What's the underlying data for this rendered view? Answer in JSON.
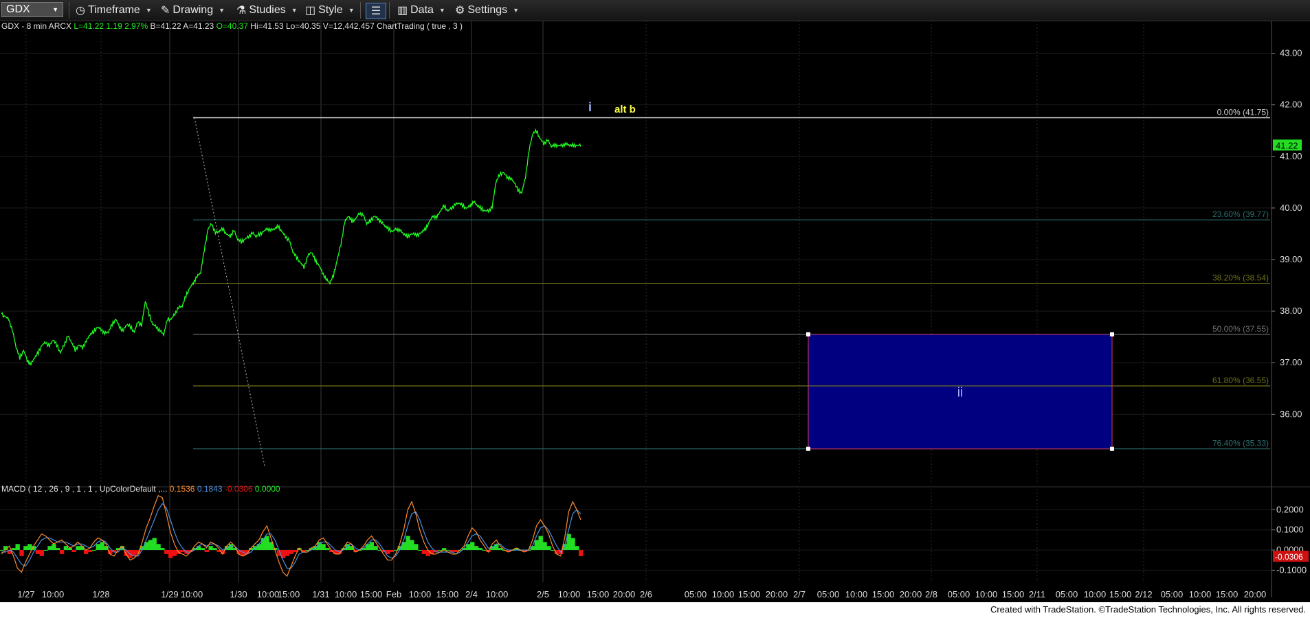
{
  "toolbar": {
    "symbol": "GDX",
    "timeframe": "Timeframe",
    "drawing": "Drawing",
    "studies": "Studies",
    "style": "Style",
    "data": "Data",
    "settings": "Settings"
  },
  "header": {
    "title": "GDX - 8 min  ARCX",
    "last": "L=41.22",
    "chg": "1.19",
    "pct": "2.97%",
    "bid": "B=41.22",
    "ask": "A=41.23",
    "open": "O=40.37",
    "high": "Hi=41.53",
    "low": "Lo=40.35",
    "volume": "V=12,442,457",
    "study": "ChartTrading ( true , 3 )"
  },
  "macd_header": {
    "title": "MACD ( 12 , 26 , 9 , 1 , 1 , UpColorDefault ,...",
    "v1": "0.1536",
    "v2": "0.1843",
    "v3": "-0.0306",
    "v4": "0.0000"
  },
  "footer": "Created with TradeStation. ©TradeStation Technologies, Inc. All rights reserved.",
  "colors": {
    "price": "#22ff22",
    "fib_0": "#d8d8d8",
    "fib_236": "#2e6e6e",
    "fib_382": "#70701e",
    "fib_50": "#707070",
    "fib_618": "#70701e",
    "fib_764": "#2e6e6e",
    "box_fill": "#000080",
    "box_border": "#b03060",
    "macd_pos": "#22dd22",
    "macd_neg": "#ee1111",
    "macd_line": "#ff8c2e",
    "signal_line": "#4a8fe0",
    "label_i": "#9fb3ff",
    "label_altb": "#ffff44",
    "last_price_bg": "#22dd22"
  },
  "chart_data": {
    "type": "line",
    "title": "GDX - 8 min",
    "ylim": [
      34.66,
      43.5
    ],
    "yticks": [
      43,
      42,
      41,
      40,
      39,
      38,
      37,
      36
    ],
    "ytick_labels": [
      "43.00",
      "42.00",
      "41.00",
      "40.00",
      "39.00",
      "38.00",
      "37.00",
      "36.00"
    ],
    "last_price": 41.22,
    "last_price_label": "41.22",
    "x_ticks": [
      "1/27",
      "10:00",
      "1/28",
      "1/29",
      "10:00",
      "1/30",
      "10:00",
      "15:00",
      "1/31",
      "10:00",
      "15:00",
      "Feb",
      "10:00",
      "15:00",
      "2/4",
      "10:00",
      "2/5",
      "10:00",
      "15:00",
      "20:00",
      "2/6",
      "05:00",
      "10:00",
      "15:00",
      "20:00",
      "2/7",
      "05:00",
      "10:00",
      "15:00",
      "20:00",
      "2/8",
      "05:00",
      "10:00",
      "15:00",
      "2/11",
      "05:00",
      "10:00",
      "15:00",
      "2/12",
      "05:00",
      "10:00",
      "15:00",
      "20:00"
    ],
    "price_series": {
      "name": "GDX",
      "x": [
        0,
        2,
        4,
        5,
        6,
        7,
        8,
        9,
        10,
        11,
        12,
        13,
        14,
        15,
        16,
        17,
        18,
        19,
        20,
        21,
        22,
        23,
        24,
        25,
        26,
        27,
        28,
        29,
        30,
        31,
        32,
        33,
        34,
        35,
        36,
        37,
        38,
        39,
        40,
        41,
        42,
        43,
        44,
        45,
        46,
        47,
        48,
        49,
        50,
        51,
        52,
        53,
        54,
        55,
        56,
        57,
        58,
        59,
        60,
        61,
        62,
        63,
        64,
        65,
        66,
        67,
        68,
        69,
        70,
        71,
        72,
        73,
        74,
        75,
        76,
        77,
        78,
        79,
        80,
        81,
        82,
        83,
        84,
        85,
        86,
        87,
        88,
        89,
        90,
        91,
        92,
        93,
        94,
        95,
        96,
        97,
        98,
        99,
        100,
        101,
        102,
        103,
        104,
        105,
        106,
        107,
        108,
        109,
        110,
        111,
        112,
        113,
        114,
        115,
        116,
        117,
        118,
        119,
        120,
        121,
        122,
        123,
        124,
        125,
        126,
        127,
        128,
        129,
        130,
        131,
        132,
        133,
        134,
        135,
        136,
        137,
        138,
        139,
        140,
        141,
        142,
        143,
        144,
        145,
        146,
        147,
        148,
        149,
        150,
        151,
        152,
        153,
        154,
        155,
        156,
        157,
        158,
        159
      ],
      "y": [
        37.95,
        37.9,
        37.85,
        37.6,
        37.3,
        37.1,
        37.25,
        37.05,
        36.95,
        37.1,
        37.2,
        37.35,
        37.4,
        37.3,
        37.45,
        37.35,
        37.2,
        37.35,
        37.5,
        37.4,
        37.25,
        37.35,
        37.3,
        37.4,
        37.55,
        37.6,
        37.7,
        37.65,
        37.55,
        37.6,
        37.75,
        37.85,
        37.7,
        37.6,
        37.75,
        37.7,
        37.6,
        37.8,
        37.7,
        38.2,
        37.95,
        37.75,
        37.7,
        37.6,
        37.55,
        37.85,
        37.85,
        37.95,
        38.05,
        38.1,
        38.3,
        38.45,
        38.55,
        38.65,
        38.75,
        39.2,
        39.6,
        39.7,
        39.5,
        39.55,
        39.6,
        39.5,
        39.45,
        39.55,
        39.4,
        39.35,
        39.4,
        39.45,
        39.5,
        39.45,
        39.5,
        39.55,
        39.6,
        39.55,
        39.6,
        39.65,
        39.55,
        39.45,
        39.35,
        39.15,
        39.05,
        38.95,
        38.85,
        39.05,
        39.15,
        39.0,
        38.9,
        38.75,
        38.6,
        38.55,
        38.7,
        39.0,
        39.3,
        39.7,
        39.85,
        39.75,
        39.8,
        39.9,
        39.85,
        39.7,
        39.75,
        39.85,
        39.8,
        39.7,
        39.65,
        39.6,
        39.55,
        39.6,
        39.55,
        39.5,
        39.45,
        39.5,
        39.5,
        39.45,
        39.55,
        39.6,
        39.75,
        39.85,
        39.8,
        39.95,
        40.05,
        39.95,
        40.0,
        40.05,
        40.1,
        40.05,
        40.0,
        40.05,
        40.1,
        40.05,
        40.0,
        39.95,
        39.95,
        40.0,
        40.5,
        40.65,
        40.7,
        40.6,
        40.55,
        40.5,
        40.35,
        40.3,
        40.6,
        41.1,
        41.45,
        41.5,
        41.35,
        41.25,
        41.3,
        41.2,
        41.22,
        41.22,
        41.22,
        41.22,
        41.22,
        41.22,
        41.22,
        41.22
      ]
    },
    "fib_levels": [
      {
        "pct": "0.00%",
        "value": 41.75,
        "label": "0.00% (41.75)"
      },
      {
        "pct": "23.60%",
        "value": 39.77,
        "label": "23.60% (39.77)"
      },
      {
        "pct": "38.20%",
        "value": 38.54,
        "label": "38.20% (38.54)"
      },
      {
        "pct": "50.00%",
        "value": 37.55,
        "label": "50.00% (37.55)"
      },
      {
        "pct": "61.80%",
        "value": 36.55,
        "label": "61.80% (36.55)"
      },
      {
        "pct": "76.40%",
        "value": 35.33,
        "label": "76.40% (35.33)"
      }
    ],
    "target_box": {
      "label": "ii",
      "top": 37.55,
      "bottom": 35.33
    },
    "annotations": [
      {
        "text": "i",
        "value": 42.0
      },
      {
        "text": "alt b",
        "value": 42.0
      }
    ],
    "macd": {
      "ylim": [
        -0.16,
        0.3
      ],
      "yticks": [
        0.2,
        0.1,
        0.0,
        -0.1
      ],
      "ytick_labels": [
        "0.2000",
        "0.1000",
        "0.0000",
        "-0.1000"
      ],
      "current_label": "-0.0306",
      "histogram": [
        0,
        0.02,
        -0.02,
        0.01,
        0.03,
        -0.03,
        0.02,
        0.03,
        0.02,
        -0.02,
        -0.03,
        0.0,
        0.02,
        0.03,
        0.01,
        -0.02,
        0.02,
        0.01,
        -0.01,
        0.02,
        0.02,
        -0.02,
        -0.01,
        0.0,
        0.03,
        0.04,
        0.02,
        -0.02,
        -0.01,
        0.01,
        0.02,
        -0.03,
        -0.04,
        -0.03,
        -0.02,
        0.02,
        0.04,
        0.05,
        0.06,
        0.03,
        0.01,
        -0.02,
        -0.04,
        -0.03,
        -0.02,
        -0.01,
        -0.02,
        -0.01,
        0.01,
        0.02,
        0.01,
        -0.01,
        0.02,
        0.01,
        -0.01,
        -0.02,
        0.02,
        0.03,
        0.01,
        -0.02,
        -0.03,
        -0.02,
        0.01,
        0.02,
        0.03,
        0.06,
        0.07,
        0.04,
        0.01,
        -0.03,
        -0.04,
        -0.03,
        -0.02,
        -0.01,
        0.01,
        -0.01,
        0.0,
        0.01,
        0.02,
        0.04,
        0.03,
        0.01,
        -0.01,
        -0.02,
        -0.02,
        0.01,
        0.03,
        0.02,
        -0.01,
        0.0,
        0.01,
        0.03,
        0.04,
        0.02,
        0.0,
        -0.01,
        -0.02,
        -0.01,
        0.0,
        0.02,
        0.04,
        0.07,
        0.05,
        0.03,
        0.0,
        -0.02,
        -0.03,
        -0.02,
        -0.01,
        0.0,
        0.01,
        0.0,
        -0.01,
        -0.01,
        0.0,
        0.01,
        0.03,
        0.04,
        0.02,
        0.01,
        0.0,
        -0.01,
        0.02,
        0.03,
        0.01,
        0.0,
        -0.01,
        0.0,
        0.01,
        0.0,
        -0.01,
        0.0,
        0.02,
        0.05,
        0.07,
        0.04,
        0.02,
        0.0,
        -0.02,
        -0.02,
        0.03,
        0.08,
        0.06,
        0.02,
        -0.03
      ],
      "macd_line": [
        -0.02,
        0.0,
        0.02,
        -0.03,
        -0.09,
        -0.11,
        -0.06,
        -0.02,
        0.02,
        0.05,
        0.08,
        0.07,
        0.05,
        0.03,
        0.04,
        0.05,
        0.03,
        0.01,
        0.02,
        0.04,
        0.02,
        0.0,
        0.01,
        0.04,
        0.06,
        0.05,
        0.03,
        -0.02,
        -0.03,
        0.0,
        0.02,
        -0.02,
        -0.05,
        -0.04,
        -0.02,
        0.04,
        0.11,
        0.16,
        0.22,
        0.27,
        0.26,
        0.18,
        0.09,
        0.03,
        -0.01,
        -0.02,
        -0.03,
        -0.01,
        0.02,
        0.04,
        0.03,
        0.01,
        0.04,
        0.03,
        0.01,
        -0.02,
        0.02,
        0.04,
        0.02,
        -0.02,
        -0.03,
        -0.02,
        0.01,
        0.03,
        0.05,
        0.09,
        0.12,
        0.06,
        0.0,
        -0.06,
        -0.11,
        -0.13,
        -0.08,
        -0.03,
        0.01,
        -0.01,
        -0.01,
        0.01,
        0.02,
        0.05,
        0.06,
        0.03,
        0.0,
        -0.02,
        -0.02,
        0.01,
        0.04,
        0.03,
        -0.01,
        0.0,
        0.02,
        0.05,
        0.07,
        0.04,
        0.01,
        -0.02,
        -0.05,
        -0.05,
        -0.02,
        0.03,
        0.1,
        0.2,
        0.24,
        0.18,
        0.1,
        0.04,
        0.0,
        -0.02,
        -0.02,
        -0.01,
        0.0,
        -0.01,
        -0.02,
        -0.02,
        0.0,
        0.02,
        0.07,
        0.11,
        0.09,
        0.05,
        0.02,
        -0.01,
        0.03,
        0.05,
        0.02,
        0.0,
        -0.01,
        0.0,
        0.01,
        0.0,
        -0.01,
        0.0,
        0.05,
        0.12,
        0.15,
        0.12,
        0.08,
        0.02,
        -0.02,
        -0.03,
        0.06,
        0.19,
        0.24,
        0.2,
        0.15
      ],
      "signal_line": [
        -0.01,
        -0.01,
        0.0,
        -0.01,
        -0.04,
        -0.07,
        -0.08,
        -0.05,
        -0.01,
        0.02,
        0.05,
        0.06,
        0.06,
        0.05,
        0.04,
        0.04,
        0.04,
        0.03,
        0.02,
        0.03,
        0.03,
        0.02,
        0.01,
        0.02,
        0.04,
        0.05,
        0.04,
        0.01,
        -0.01,
        -0.01,
        0.01,
        0.0,
        -0.02,
        -0.03,
        -0.03,
        0.0,
        0.05,
        0.1,
        0.15,
        0.2,
        0.23,
        0.21,
        0.15,
        0.09,
        0.04,
        0.01,
        -0.01,
        -0.01,
        0.0,
        0.02,
        0.03,
        0.02,
        0.03,
        0.03,
        0.02,
        0.0,
        0.01,
        0.02,
        0.02,
        0.0,
        -0.01,
        -0.02,
        -0.01,
        0.01,
        0.03,
        0.05,
        0.08,
        0.08,
        0.05,
        0.0,
        -0.05,
        -0.09,
        -0.09,
        -0.06,
        -0.02,
        -0.01,
        -0.01,
        0.0,
        0.01,
        0.03,
        0.04,
        0.04,
        0.02,
        0.0,
        -0.01,
        0.0,
        0.02,
        0.03,
        0.01,
        0.0,
        0.01,
        0.03,
        0.05,
        0.05,
        0.03,
        0.0,
        -0.03,
        -0.04,
        -0.03,
        0.0,
        0.05,
        0.12,
        0.18,
        0.19,
        0.15,
        0.09,
        0.04,
        0.01,
        -0.01,
        -0.01,
        -0.01,
        -0.01,
        -0.01,
        -0.02,
        -0.01,
        0.01,
        0.04,
        0.07,
        0.08,
        0.07,
        0.04,
        0.01,
        0.01,
        0.03,
        0.03,
        0.01,
        0.0,
        0.0,
        0.0,
        0.0,
        0.0,
        0.0,
        0.02,
        0.07,
        0.11,
        0.12,
        0.1,
        0.06,
        0.02,
        -0.01,
        0.02,
        0.1,
        0.18,
        0.2,
        0.18
      ]
    }
  }
}
